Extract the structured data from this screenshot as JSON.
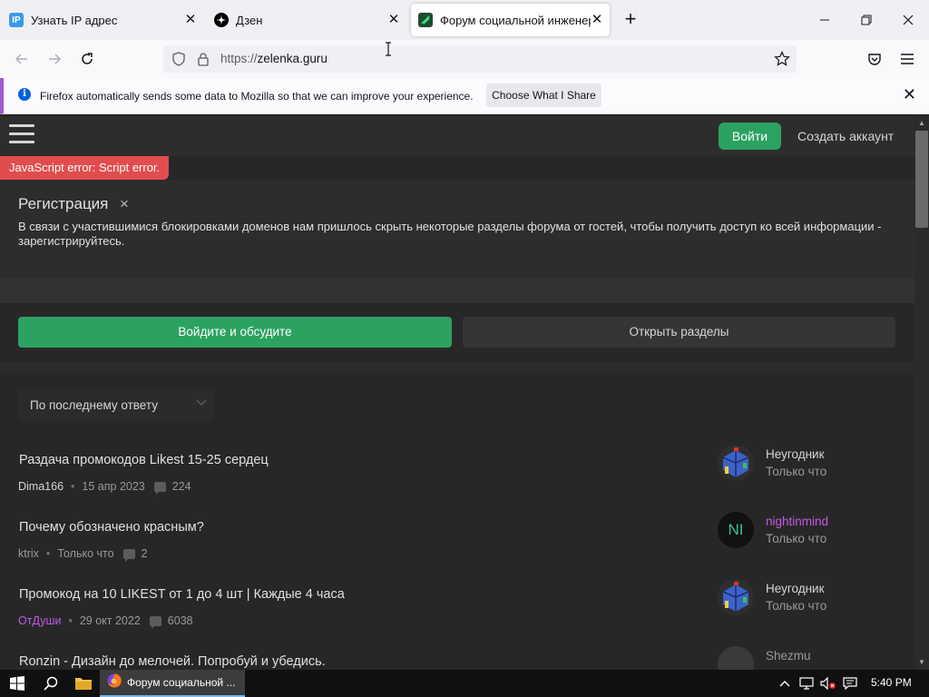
{
  "browser": {
    "tabs": [
      {
        "title": "Узнать IP адрес",
        "favicon": "ip-icon"
      },
      {
        "title": "Дзен",
        "favicon": "zen-icon"
      },
      {
        "title": "Форум социальной инженери",
        "favicon": "lolz-icon",
        "active": true
      }
    ],
    "url": {
      "scheme": "https://",
      "host": "zelenka.guru"
    },
    "notification": {
      "message": "Firefox automatically sends some data to Mozilla so that we can improve your experience.",
      "button": "Choose What I Share"
    }
  },
  "site": {
    "header": {
      "login": "Войти",
      "signup": "Создать аккаунт"
    },
    "js_error": "JavaScript error: Script error.",
    "registration": {
      "title": "Регистрация",
      "close": "×",
      "text": "В связи с участившимися блокировками доменов нам пришлось скрыть некоторые разделы форума от гостей, чтобы получить доступ ко всей информации - зарегистрируйтесь."
    },
    "actions": {
      "primary": "Войдите и обсудите",
      "secondary": "Открыть разделы"
    },
    "sort": {
      "selected": "По последнему ответу"
    },
    "threads": [
      {
        "title": "Раздача промокодов Likest 15-25 сердец",
        "author": "Dima166",
        "author_color": "#d6d6d6",
        "date": "15 апр 2023",
        "replies": "224",
        "last_user": "Неугодник",
        "last_user_color": "#d6d6d6",
        "last_time": "Только что",
        "avatar": "cube"
      },
      {
        "title": "Почему обозначено красным?",
        "author": "ktrix",
        "author_color": "#d6d6d6",
        "date": "Только что",
        "replies": "2",
        "last_user": "nightinmind",
        "last_user_color": "#c05be6",
        "last_time": "Только что",
        "avatar": "NI"
      },
      {
        "title": "Промокод на 10 LIKEST от 1 до 4 шт | Каждые 4 часа",
        "author": "ОтДуши",
        "author_color": "#c05be6",
        "date": "29 окт 2022",
        "replies": "6038",
        "last_user": "Неугодник",
        "last_user_color": "#d6d6d6",
        "last_time": "Только что",
        "avatar": "cube"
      },
      {
        "title": "Ronzin - Дизайн до мелочей. Попробуй и убедись.",
        "author": "",
        "date": "",
        "replies": "",
        "last_user": "Shezmu",
        "last_user_color": "#9a9a9a",
        "last_time": "",
        "avatar": "dark"
      }
    ]
  },
  "taskbar": {
    "window_label": "Форум социальной ...",
    "time": "5:40 PM"
  },
  "colors": {
    "accent_green": "#2ba260",
    "page_bg": "#272727",
    "error_red": "#e14d4d",
    "purple_user": "#c05be6"
  }
}
